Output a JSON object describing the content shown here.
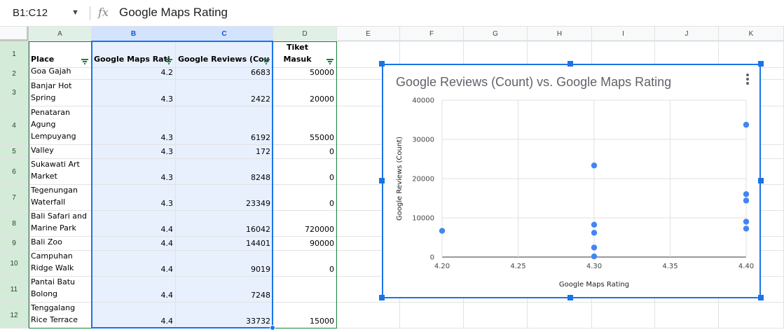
{
  "formula_bar": {
    "name_box": "B1:C12",
    "fx": "fx",
    "value": "Google Maps Rating"
  },
  "columns": [
    "A",
    "B",
    "C",
    "D",
    "E",
    "F",
    "G",
    "H",
    "I",
    "J",
    "K"
  ],
  "headers": {
    "place": "Place",
    "rating": "Google Maps Rati",
    "reviews": "Google Reviews (Cou",
    "ticket": "Harga Tiket Masuk"
  },
  "rows": [
    {
      "num": "1"
    },
    {
      "num": "2",
      "place": "Goa Gajah",
      "rating": "4.2",
      "reviews": "6683",
      "ticket": "50000"
    },
    {
      "num": "3",
      "place": "Banjar Hot Spring",
      "rating": "4.3",
      "reviews": "2422",
      "ticket": "20000"
    },
    {
      "num": "4",
      "place": "Pura Penataran Agung Lempuyang",
      "rating": "4.3",
      "reviews": "6192",
      "ticket": "55000"
    },
    {
      "num": "5",
      "place": "Sidemen Valley",
      "rating": "4.3",
      "reviews": "172",
      "ticket": "0"
    },
    {
      "num": "6",
      "place": "Sukawati Art Market",
      "rating": "4.3",
      "reviews": "8248",
      "ticket": "0"
    },
    {
      "num": "7",
      "place": "Tegenungan Waterfall",
      "rating": "4.3",
      "reviews": "23349",
      "ticket": "0"
    },
    {
      "num": "8",
      "place": "Bali Safari and Marine Park",
      "rating": "4.4",
      "reviews": "16042",
      "ticket": "720000"
    },
    {
      "num": "9",
      "place": "Bali Zoo",
      "rating": "4.4",
      "reviews": "14401",
      "ticket": "90000"
    },
    {
      "num": "10",
      "place": "Campuhan Ridge Walk",
      "rating": "4.4",
      "reviews": "9019",
      "ticket": "0"
    },
    {
      "num": "11",
      "place": "Pantai Batu Bolong",
      "rating": "4.4",
      "reviews": "7248",
      "ticket": ""
    },
    {
      "num": "12",
      "place": "Tenggalang Rice Terrace",
      "rating": "4.4",
      "reviews": "33732",
      "ticket": "15000"
    }
  ],
  "chart_data": {
    "type": "scatter",
    "title": "Google Reviews (Count) vs. Google Maps Rating",
    "xlabel": "Google Maps Rating",
    "ylabel": "Google Reviews (Count)",
    "xlim": [
      4.2,
      4.4
    ],
    "ylim": [
      0,
      40000
    ],
    "xticks": [
      "4.20",
      "4.25",
      "4.30",
      "4.35",
      "4.40"
    ],
    "yticks": [
      "0",
      "10000",
      "20000",
      "30000",
      "40000"
    ],
    "grid": true,
    "color": "#4285f4",
    "x": [
      4.2,
      4.3,
      4.3,
      4.3,
      4.3,
      4.3,
      4.4,
      4.4,
      4.4,
      4.4,
      4.4
    ],
    "y": [
      6683,
      2422,
      6192,
      172,
      8248,
      23349,
      16042,
      14401,
      9019,
      7248,
      33732
    ]
  }
}
